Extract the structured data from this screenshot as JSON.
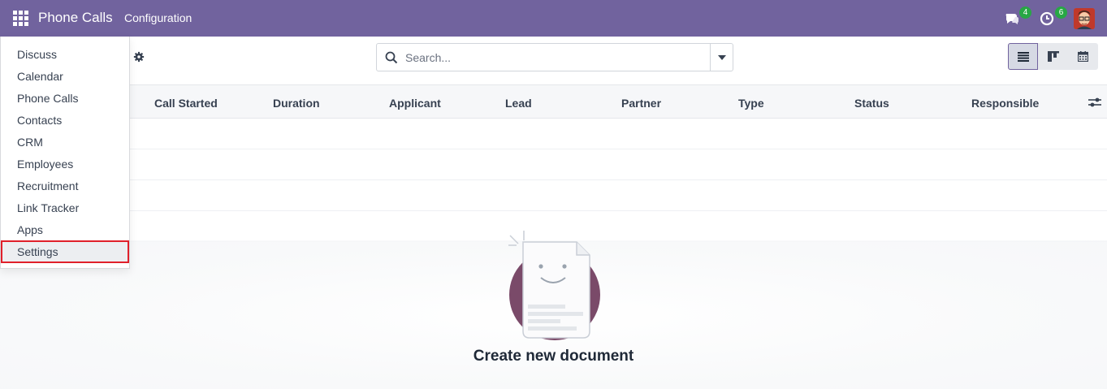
{
  "navbar": {
    "app_name": "Phone Calls",
    "menu_config": "Configuration",
    "messages_count": "4",
    "activities_count": "6"
  },
  "search": {
    "placeholder": "Search..."
  },
  "columns": [
    "Call Started",
    "Duration",
    "Applicant",
    "Lead",
    "Partner",
    "Type",
    "Status",
    "Responsible"
  ],
  "empty_state": {
    "title": "Create new document"
  },
  "app_menu": {
    "items": [
      "Discuss",
      "Calendar",
      "Phone Calls",
      "Contacts",
      "CRM",
      "Employees",
      "Recruitment",
      "Link Tracker",
      "Apps",
      "Settings"
    ],
    "highlighted": "Settings"
  },
  "colors": {
    "navbar": "#71639e",
    "badge": "#28a745",
    "highlight_outline": "#e0202b"
  }
}
